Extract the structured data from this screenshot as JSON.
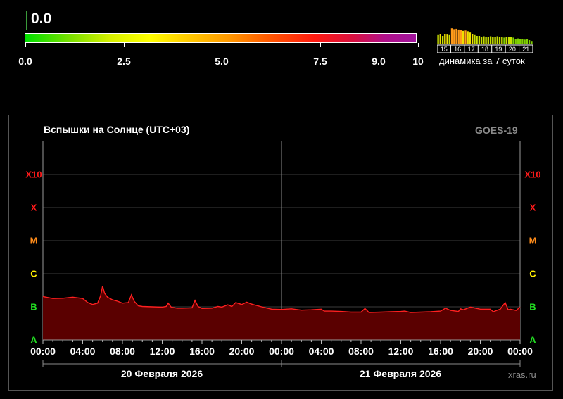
{
  "header": {
    "current_value": "0.0",
    "scale_ticks": [
      {
        "label": "0.0",
        "value": 0
      },
      {
        "label": "2.5",
        "value": 2.5
      },
      {
        "label": "5.0",
        "value": 5
      },
      {
        "label": "7.5",
        "value": 7.5
      },
      {
        "label": "9.0",
        "value": 9
      },
      {
        "label": "10",
        "value": 10
      }
    ],
    "scale_max": 10,
    "mini_chart": {
      "day_labels": [
        "15",
        "16",
        "17",
        "18",
        "19",
        "20",
        "21"
      ],
      "bar_levels": [
        0.55,
        0.6,
        0.5,
        0.62,
        0.58,
        0.55,
        0.95,
        0.9,
        0.92,
        0.88,
        0.85,
        0.8,
        0.82,
        0.78,
        0.7,
        0.62,
        0.55,
        0.5,
        0.5,
        0.45,
        0.48,
        0.46,
        0.44,
        0.48,
        0.46,
        0.44,
        0.48,
        0.45,
        0.42,
        0.4,
        0.42,
        0.46,
        0.44,
        0.4,
        0.3,
        0.35,
        0.32,
        0.3,
        0.28,
        0.3,
        0.25,
        0.2
      ],
      "caption": "динамика за 7 суток"
    }
  },
  "colors": {
    "flux_line": "#ff2020",
    "flux_fill": "#5a0000",
    "class_x10": "#ff1a1a",
    "class_x": "#ff1a1a",
    "class_m": "#ff8c1a",
    "class_c": "#ffee00",
    "class_b": "#22dd22",
    "class_a": "#22dd22"
  },
  "chart_data": {
    "type": "area",
    "title": "Вспышки на Солнце (UTC+03)",
    "satellite": "GOES-19",
    "source": "xras.ru",
    "y_scale": "log",
    "y_levels": [
      "A",
      "B",
      "C",
      "M",
      "X",
      "X10"
    ],
    "x_tick_labels": [
      "00:00",
      "04:00",
      "08:00",
      "12:00",
      "16:00",
      "20:00",
      "00:00",
      "04:00",
      "08:00",
      "12:00",
      "16:00",
      "20:00",
      "00:00"
    ],
    "date_labels": [
      "20 Февраля 2026",
      "21 Февраля 2026"
    ],
    "x_unit": "hours since 20 Feb 2026 00:00",
    "xlim": [
      0,
      48
    ],
    "series": [
      {
        "points": [
          [
            0,
            1.8
          ],
          [
            1,
            1.74
          ],
          [
            2,
            1.75
          ],
          [
            3,
            1.78
          ],
          [
            4,
            1.74
          ],
          [
            4.5,
            1.62
          ],
          [
            5,
            1.56
          ],
          [
            5.5,
            1.6
          ],
          [
            5.8,
            1.82
          ],
          [
            6.0,
            2.12
          ],
          [
            6.2,
            1.9
          ],
          [
            6.5,
            1.78
          ],
          [
            7.0,
            1.7
          ],
          [
            7.5,
            1.66
          ],
          [
            8,
            1.6
          ],
          [
            8.6,
            1.62
          ],
          [
            8.9,
            1.85
          ],
          [
            9.2,
            1.65
          ],
          [
            9.6,
            1.52
          ],
          [
            10,
            1.5
          ],
          [
            11,
            1.49
          ],
          [
            12,
            1.48
          ],
          [
            12.4,
            1.5
          ],
          [
            12.6,
            1.6
          ],
          [
            12.9,
            1.48
          ],
          [
            13.5,
            1.45
          ],
          [
            14,
            1.45
          ],
          [
            15,
            1.46
          ],
          [
            15.3,
            1.68
          ],
          [
            15.6,
            1.5
          ],
          [
            16,
            1.44
          ],
          [
            17,
            1.45
          ],
          [
            17.6,
            1.5
          ],
          [
            18,
            1.48
          ],
          [
            18.6,
            1.55
          ],
          [
            19,
            1.5
          ],
          [
            19.4,
            1.62
          ],
          [
            20,
            1.56
          ],
          [
            20.5,
            1.63
          ],
          [
            21,
            1.57
          ],
          [
            22,
            1.49
          ],
          [
            23,
            1.42
          ],
          [
            24,
            1.41
          ],
          [
            25,
            1.43
          ],
          [
            26,
            1.39
          ],
          [
            27,
            1.4
          ],
          [
            28,
            1.42
          ],
          [
            28.3,
            1.36
          ],
          [
            29,
            1.36
          ],
          [
            30,
            1.35
          ],
          [
            31,
            1.33
          ],
          [
            32,
            1.33
          ],
          [
            32.4,
            1.44
          ],
          [
            32.8,
            1.32
          ],
          [
            34,
            1.33
          ],
          [
            35,
            1.34
          ],
          [
            36,
            1.35
          ],
          [
            36.4,
            1.36
          ],
          [
            37,
            1.32
          ],
          [
            38,
            1.33
          ],
          [
            39,
            1.34
          ],
          [
            40,
            1.36
          ],
          [
            40.5,
            1.45
          ],
          [
            41,
            1.38
          ],
          [
            41.8,
            1.35
          ],
          [
            42,
            1.43
          ],
          [
            42.3,
            1.4
          ],
          [
            43,
            1.48
          ],
          [
            44,
            1.42
          ],
          [
            45,
            1.42
          ],
          [
            45.3,
            1.34
          ],
          [
            46,
            1.42
          ],
          [
            46.5,
            1.62
          ],
          [
            46.8,
            1.4
          ],
          [
            47,
            1.42
          ],
          [
            47.6,
            1.38
          ],
          [
            48,
            1.48
          ]
        ]
      }
    ]
  }
}
